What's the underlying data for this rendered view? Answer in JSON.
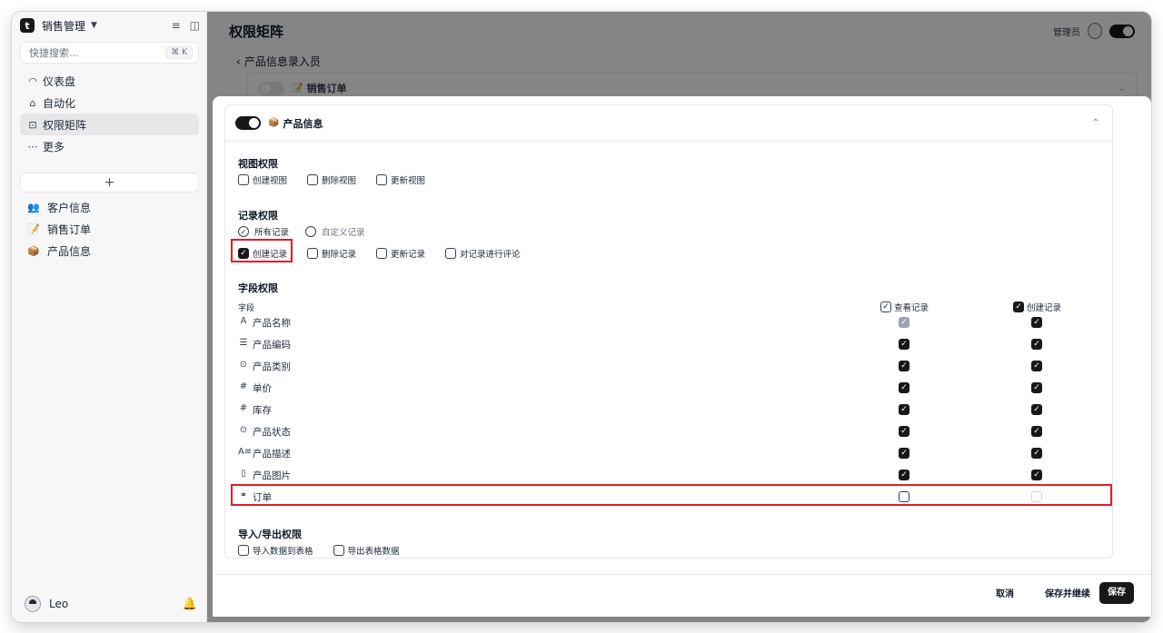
{
  "workspace": {
    "name": "销售管理",
    "search_placeholder": "快捷搜索...",
    "search_shortcut": "⌘ K"
  },
  "sidebar": {
    "nav": [
      {
        "icon": "◠",
        "label": "仪表盘"
      },
      {
        "icon": "⌂",
        "label": "自动化"
      },
      {
        "icon": "⊡",
        "label": "权限矩阵"
      },
      {
        "icon": "⋯",
        "label": "更多"
      }
    ],
    "add_label": "+",
    "tables": [
      {
        "emoji": "👥",
        "label": "客户信息"
      },
      {
        "emoji": "📝",
        "label": "销售订单"
      },
      {
        "emoji": "📦",
        "label": "产品信息"
      }
    ],
    "user_name": "Leo"
  },
  "main": {
    "title": "权限矩阵",
    "admin_label": "管理员",
    "back_label": "产品信息录入员",
    "background_card": {
      "emoji": "📝",
      "label": "销售订单"
    }
  },
  "sheet": {
    "card_emoji": "📦",
    "card_label": "产品信息",
    "view_section": {
      "title": "视图权限",
      "options": [
        "创建视图",
        "删除视图",
        "更新视图"
      ]
    },
    "record_section": {
      "title": "记录权限",
      "radios": [
        "所有记录",
        "自定义记录"
      ],
      "options": [
        "创建记录",
        "删除记录",
        "更新记录",
        "对记录进行评论"
      ]
    },
    "field_section": {
      "title": "字段权限",
      "field_col": "字段",
      "col_view": "查看记录",
      "col_create": "创建记录",
      "rows": [
        {
          "icon": "A",
          "name": "产品名称"
        },
        {
          "icon": "☰",
          "name": "产品编码"
        },
        {
          "icon": "⊙",
          "name": "产品类别"
        },
        {
          "icon": "#",
          "name": "单价"
        },
        {
          "icon": "#",
          "name": "库存"
        },
        {
          "icon": "⊙",
          "name": "产品状态"
        },
        {
          "icon": "A≡",
          "name": "产品描述"
        },
        {
          "icon": "▯",
          "name": "产品图片"
        },
        {
          "icon": "⚭",
          "name": "订单"
        }
      ]
    },
    "import_section": {
      "title": "导入/导出权限",
      "options": [
        "导入数据到表格",
        "导出表格数据"
      ]
    },
    "footer": {
      "cancel": "取消",
      "save_continue": "保存并继续",
      "save": "保存"
    }
  }
}
